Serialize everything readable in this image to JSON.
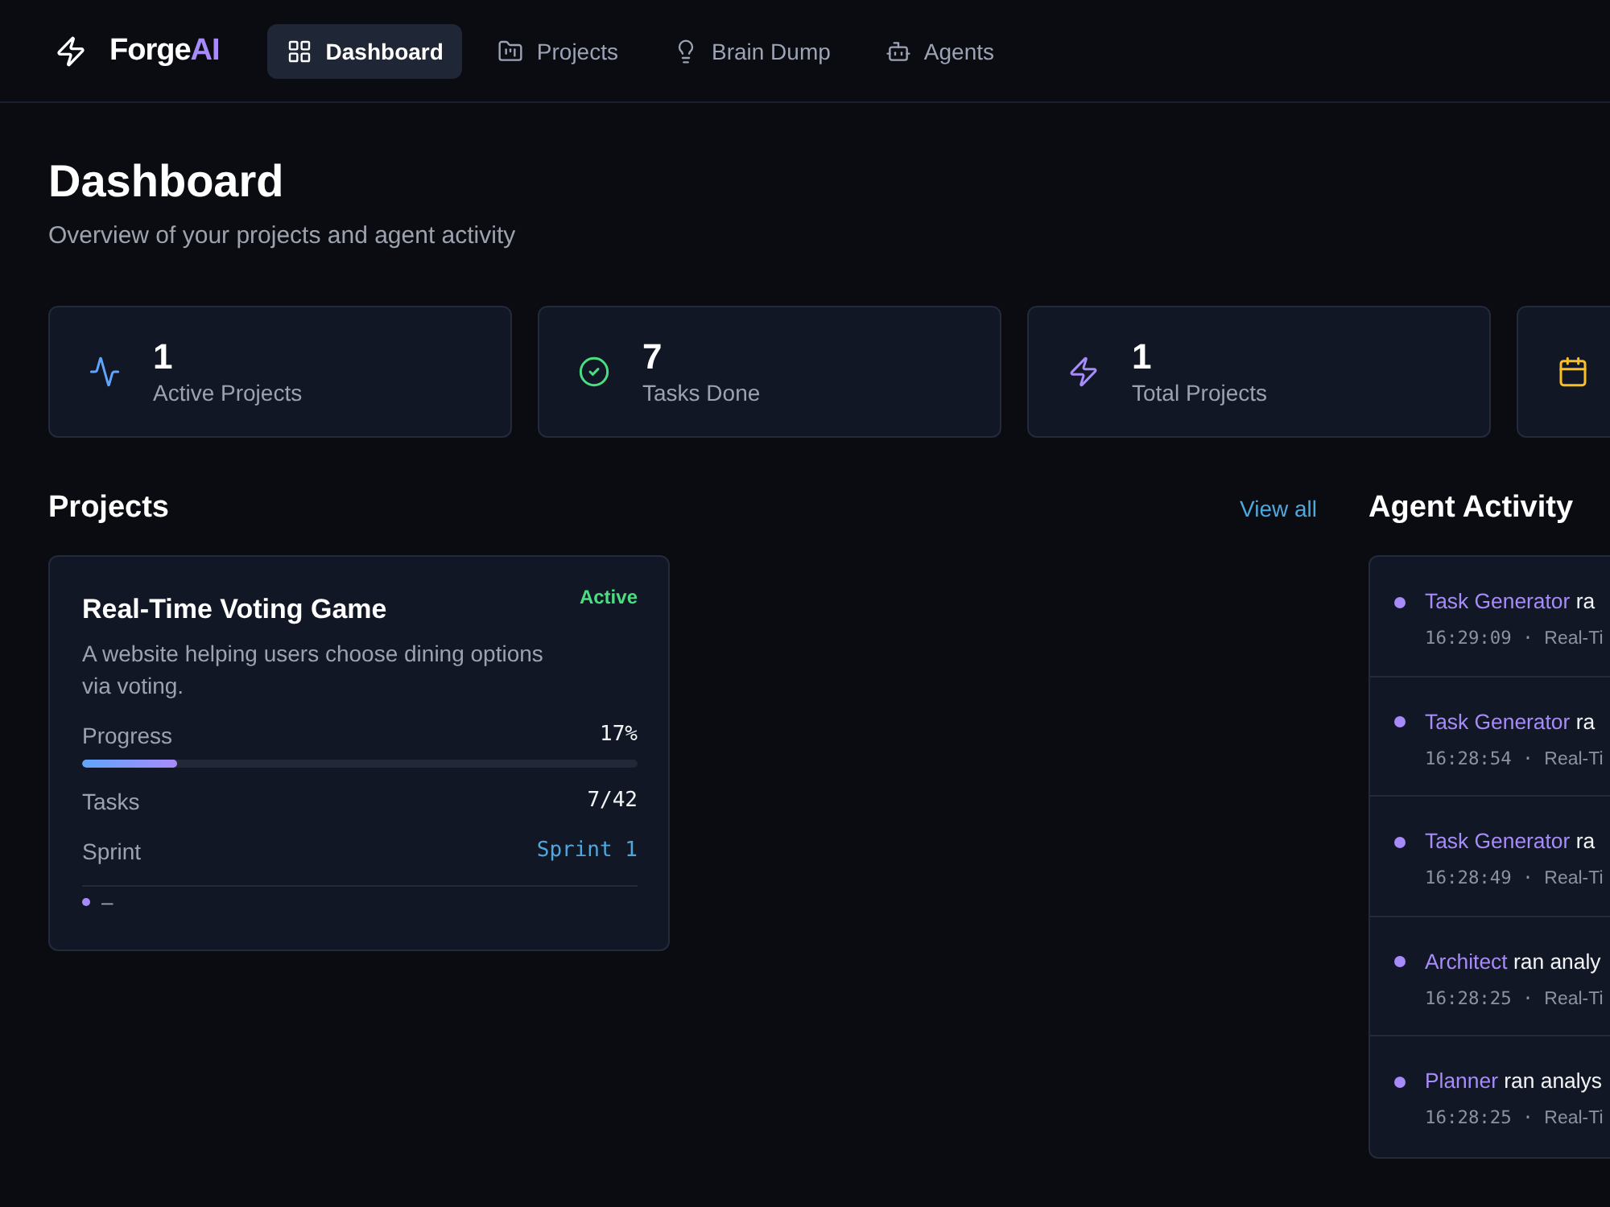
{
  "nav": {
    "logo": {
      "text": "Forge",
      "accent": "AI"
    },
    "items": [
      {
        "label": "Dashboard",
        "selected": true
      },
      {
        "label": "Projects",
        "selected": false
      },
      {
        "label": "Brain Dump",
        "selected": false
      },
      {
        "label": "Agents",
        "selected": false
      }
    ]
  },
  "header": {
    "title": "Dashboard",
    "subtitle": "Overview of your projects and agent activity"
  },
  "stats": [
    {
      "value": "1",
      "label": "Active Projects",
      "color": "#60a5fa"
    },
    {
      "value": "7",
      "label": "Tasks Done",
      "color": "#4ade80"
    },
    {
      "value": "1",
      "label": "Total Projects",
      "color": "#a78bfa"
    },
    {
      "color": "#fbbf24"
    }
  ],
  "projects": {
    "title": "Projects",
    "link": "View all",
    "cards": [
      {
        "title": "Real-Time Voting Game",
        "status": "Active",
        "description": "A website helping users choose dining options via voting.",
        "progress": {
          "label": "Progress",
          "reading": "17%",
          "level": 0.17
        },
        "tasks": {
          "label": "Tasks",
          "value": "7/42"
        },
        "sprint": {
          "label": "Sprint",
          "value": "Sprint 1"
        },
        "footer": {
          "color": "#a78bfa",
          "text": "–"
        }
      }
    ]
  },
  "activity": {
    "title": "Agent Activity",
    "items": [
      {
        "agent": "Task Generator",
        "action": "ra",
        "time": "16:29:09",
        "separator": "·",
        "project": "Real-Ti",
        "color": "#a78bfa"
      },
      {
        "agent": "Task Generator",
        "action": "ra",
        "time": "16:28:54",
        "separator": "·",
        "project": "Real-Ti",
        "color": "#a78bfa"
      },
      {
        "agent": "Task Generator",
        "action": "ra",
        "time": "16:28:49",
        "separator": "·",
        "project": "Real-Ti",
        "color": "#a78bfa"
      },
      {
        "agent": "Architect",
        "action": "ran analy",
        "time": "16:28:25",
        "separator": "·",
        "project": "Real-Ti",
        "color": "#a78bfa"
      },
      {
        "agent": "Planner",
        "action": "ran analys",
        "time": "16:28:25",
        "separator": "·",
        "project": "Real-Ti",
        "color": "#a78bfa"
      }
    ]
  }
}
